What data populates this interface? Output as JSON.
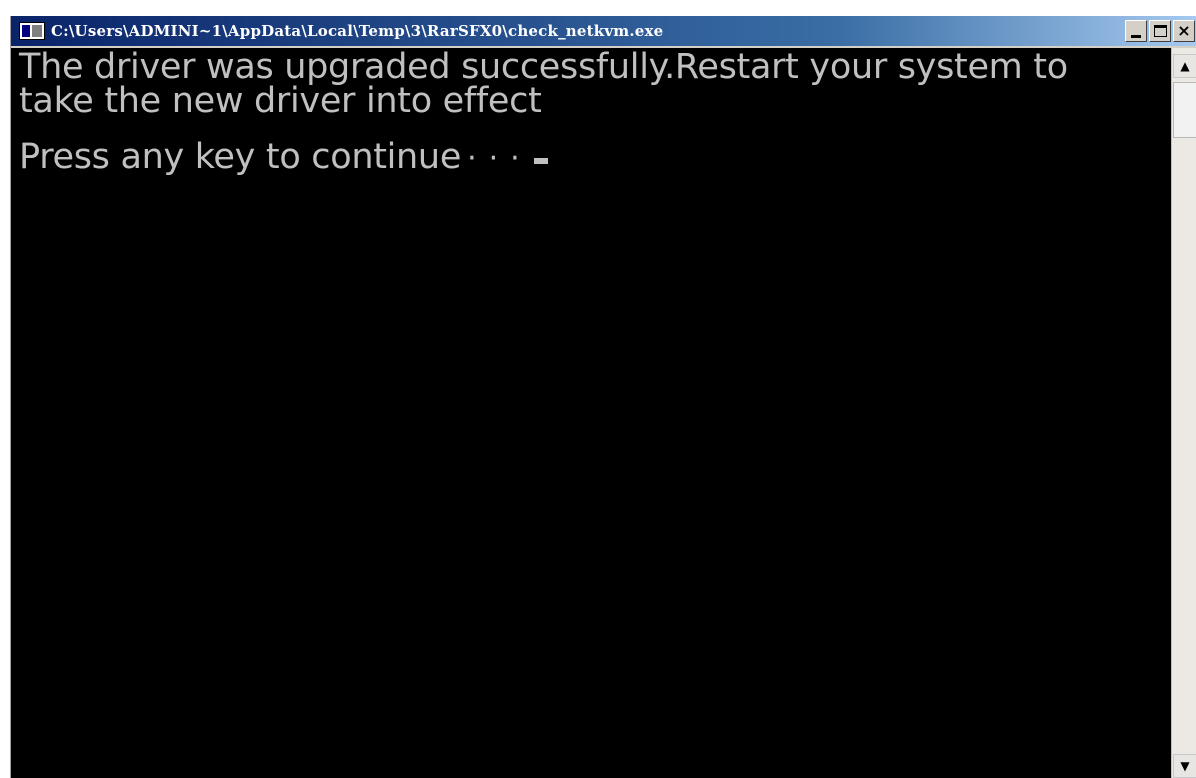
{
  "window": {
    "title": "C:\\Users\\ADMINI~1\\AppData\\Local\\Temp\\3\\RarSFX0\\check_netkvm.exe",
    "icon": "console-app-icon",
    "controls": {
      "minimize_icon": "minimize-icon",
      "maximize_icon": "maximize-icon",
      "close_label": "×"
    }
  },
  "console": {
    "lines": [
      "The driver was upgraded successfully.Restart your system to",
      "take the new driver into effect"
    ],
    "prompt": "Press any key to continue",
    "prompt_dots": "···",
    "colors": {
      "background": "#000000",
      "text": "#c0c0c0"
    }
  },
  "scrollbar": {
    "up_arrow": "▲",
    "down_arrow": "▼"
  }
}
